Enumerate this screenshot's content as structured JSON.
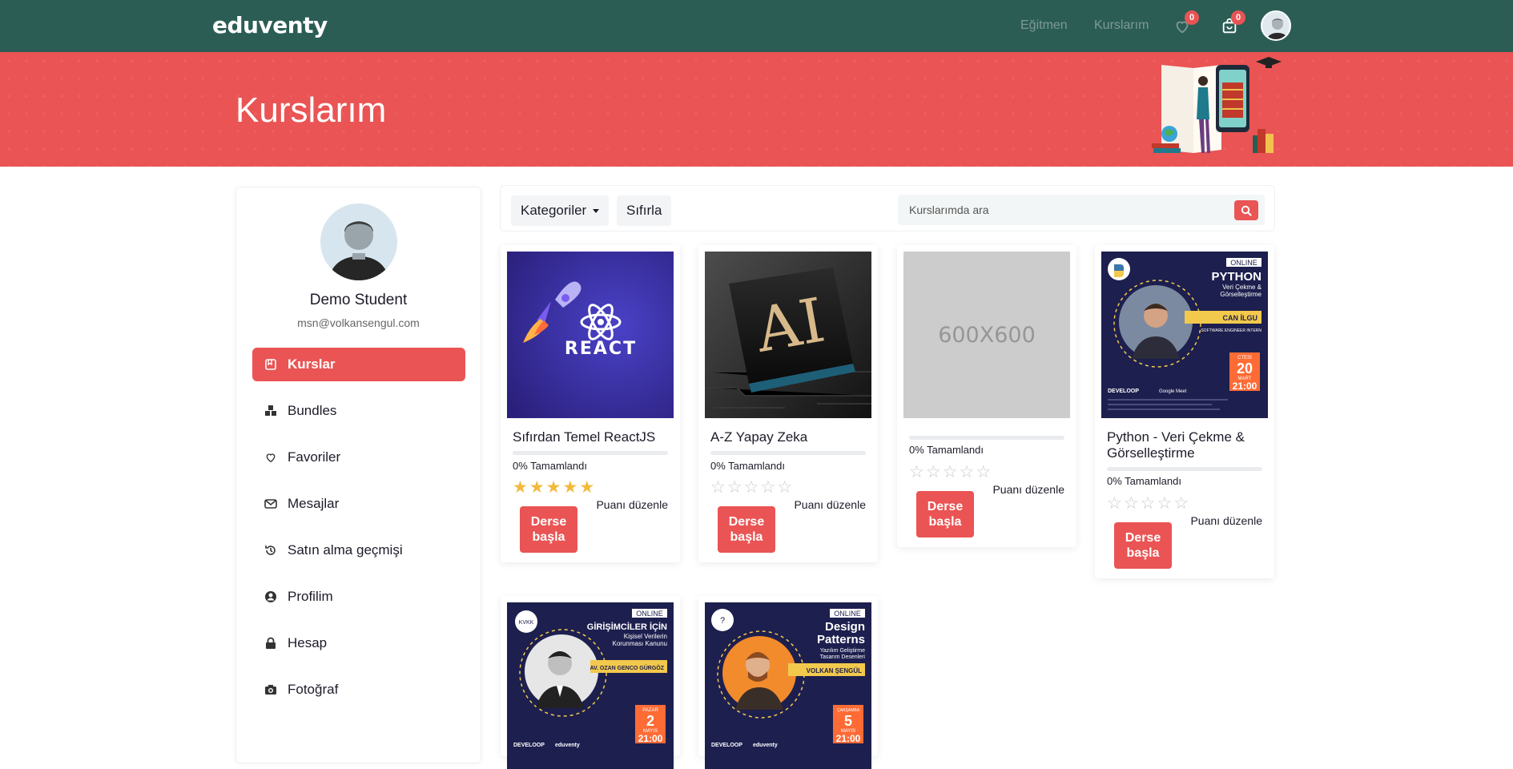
{
  "nav": {
    "logo": "eduventy",
    "links": [
      "Eğitmen",
      "Kurslarım"
    ],
    "favorites_count": "0",
    "cart_count": "0"
  },
  "hero": {
    "title": "Kurslarım"
  },
  "sidebar": {
    "name": "Demo Student",
    "email": "msn@volkansengul.com",
    "items": [
      {
        "label": "Kurslar",
        "icon": "book-icon"
      },
      {
        "label": "Bundles",
        "icon": "cubes-icon"
      },
      {
        "label": "Favoriler",
        "icon": "heart-icon"
      },
      {
        "label": "Mesajlar",
        "icon": "envelope-icon"
      },
      {
        "label": "Satın alma geçmişi",
        "icon": "history-icon"
      },
      {
        "label": "Profilim",
        "icon": "user-circle-icon"
      },
      {
        "label": "Hesap",
        "icon": "lock-icon"
      },
      {
        "label": "Fotoğraf",
        "icon": "camera-icon"
      }
    ]
  },
  "filters": {
    "categories_label": "Kategoriler",
    "reset_label": "Sıfırla",
    "search_placeholder": "Kurslarımda ara"
  },
  "courses": [
    {
      "title": "Sıfırdan Temel ReactJS",
      "progress_text": "0% Tamamlandı",
      "progress": 0,
      "rating": 5,
      "rate_label": "Puanı düzenle",
      "start_label": "Derse başla",
      "thumb_text": "REACT"
    },
    {
      "title": "A-Z Yapay Zeka",
      "progress_text": "0% Tamamlandı",
      "progress": 0,
      "rating": 0,
      "rate_label": "Puanı düzenle",
      "start_label": "Derse başla",
      "thumb_text": "AI"
    },
    {
      "title": "",
      "progress_text": "0% Tamamlandı",
      "progress": 0,
      "rating": 0,
      "rate_label": "Puanı düzenle",
      "start_label": "Derse başla",
      "thumb_text": "600X600"
    },
    {
      "title": "Python - Veri Çekme & Görselleştirme",
      "progress_text": "0% Tamamlandı",
      "progress": 0,
      "rating": 0,
      "rate_label": "Puanı düzenle",
      "start_label": "Derse başla",
      "thumb": {
        "badge": "ONLINE",
        "title": "PYTHON",
        "subtitle1": "Veri Çekme &",
        "subtitle2": "Görselleştirme",
        "speaker": "CAN İLGU",
        "role": "SOFTWARE ENGINEER INTERN",
        "day": "CTESİ",
        "date": "20",
        "month": "MART",
        "time": "21:00",
        "org": "DEVELOOP",
        "meet": "Google Meet"
      }
    },
    {
      "thumb": {
        "badge": "ONLINE",
        "tag": "KVKK",
        "title": "GİRİŞİMCİLER İÇİN",
        "subtitle1": "Kişisel Verilerin",
        "subtitle2": "Korunması Kanunu",
        "speaker": "AV. OZAN GENCO GÜRGÖZ",
        "day": "PAZAR",
        "date": "2",
        "month": "MAYIS",
        "time": "21:00",
        "org": "DEVELOOP",
        "partner": "eduventy"
      }
    },
    {
      "thumb": {
        "badge": "ONLINE",
        "tag": "?",
        "title": "Design",
        "title2": "Patterns",
        "subtitle1": "Yazılım Geliştirme",
        "subtitle2": "Tasarım Desenleri",
        "speaker": "VOLKAN ŞENGÜL",
        "day": "ÇARŞAMBA",
        "date": "5",
        "month": "MAYIS",
        "time": "21:00",
        "org": "DEVELOOP",
        "partner": "eduventy"
      }
    }
  ]
}
